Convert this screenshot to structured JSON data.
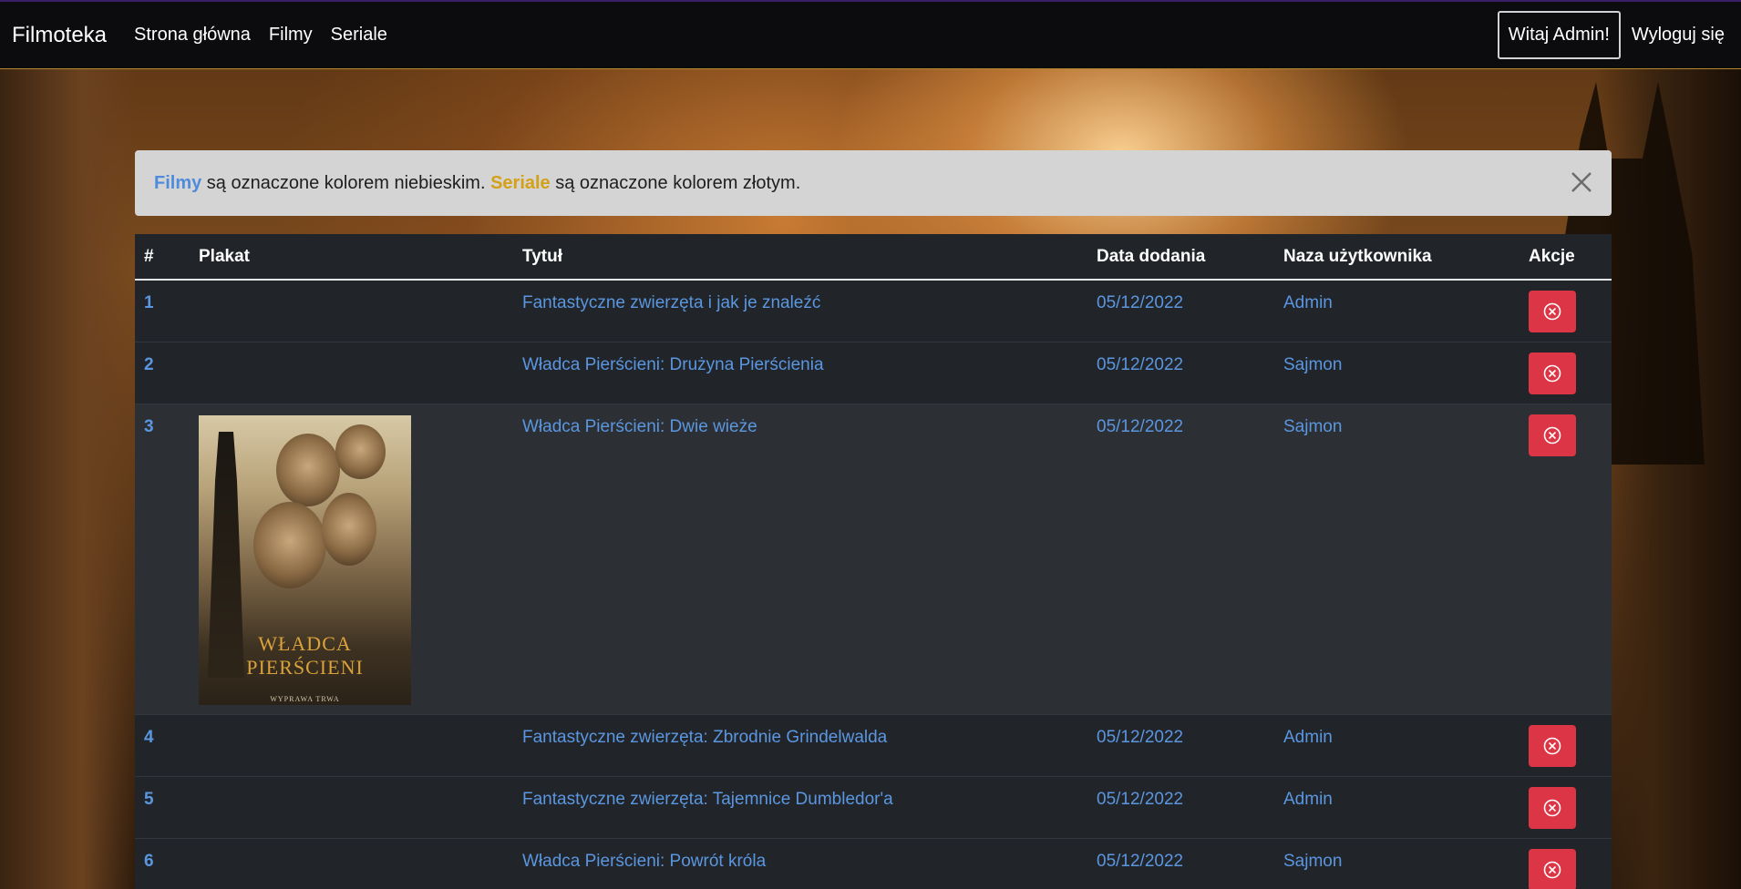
{
  "navbar": {
    "brand": "Filmoteka",
    "links": [
      "Strona główna",
      "Filmy",
      "Seriale"
    ],
    "welcome": "Witaj Admin!",
    "logout": "Wyloguj się"
  },
  "alert": {
    "films_word": "Filmy",
    "films_text": " są oznaczone kolorem niebieskim. ",
    "series_word": "Seriale",
    "series_text": " są oznaczone kolorem złotym.",
    "films_color": "#4e8cdb",
    "series_color": "#d4a017"
  },
  "table": {
    "headers": [
      "#",
      "Plakat",
      "Tytuł",
      "Data dodania",
      "Naza użytkownika",
      "Akcje"
    ],
    "rows": [
      {
        "num": "1",
        "title": "Fantastyczne zwierzęta i jak je znaleźć",
        "date": "05/12/2022",
        "user": "Admin",
        "has_poster": false
      },
      {
        "num": "2",
        "title": "Władca Pierścieni: Drużyna Pierścienia",
        "date": "05/12/2022",
        "user": "Sajmon",
        "has_poster": false
      },
      {
        "num": "3",
        "title": "Władca Pierścieni: Dwie wieże",
        "date": "05/12/2022",
        "user": "Sajmon",
        "has_poster": true
      },
      {
        "num": "4",
        "title": "Fantastyczne zwierzęta: Zbrodnie Grindelwalda",
        "date": "05/12/2022",
        "user": "Admin",
        "has_poster": false
      },
      {
        "num": "5",
        "title": "Fantastyczne zwierzęta: Tajemnice Dumbledor'a",
        "date": "05/12/2022",
        "user": "Admin",
        "has_poster": false
      },
      {
        "num": "6",
        "title": "Władca Pierścieni: Powrót króla",
        "date": "05/12/2022",
        "user": "Sajmon",
        "has_poster": false
      }
    ],
    "poster": {
      "title_text": "WŁADCA PIERŚCIENI",
      "sub_text": "WYPRAWA TRWA"
    }
  },
  "colors": {
    "link_blue": "#5b96e0",
    "delete_red": "#dc3545",
    "table_bg": "#212529",
    "navbar_bg": "#0c0c0e"
  },
  "icons": {
    "alert_close": "close-icon",
    "delete": "x-circle-icon"
  }
}
